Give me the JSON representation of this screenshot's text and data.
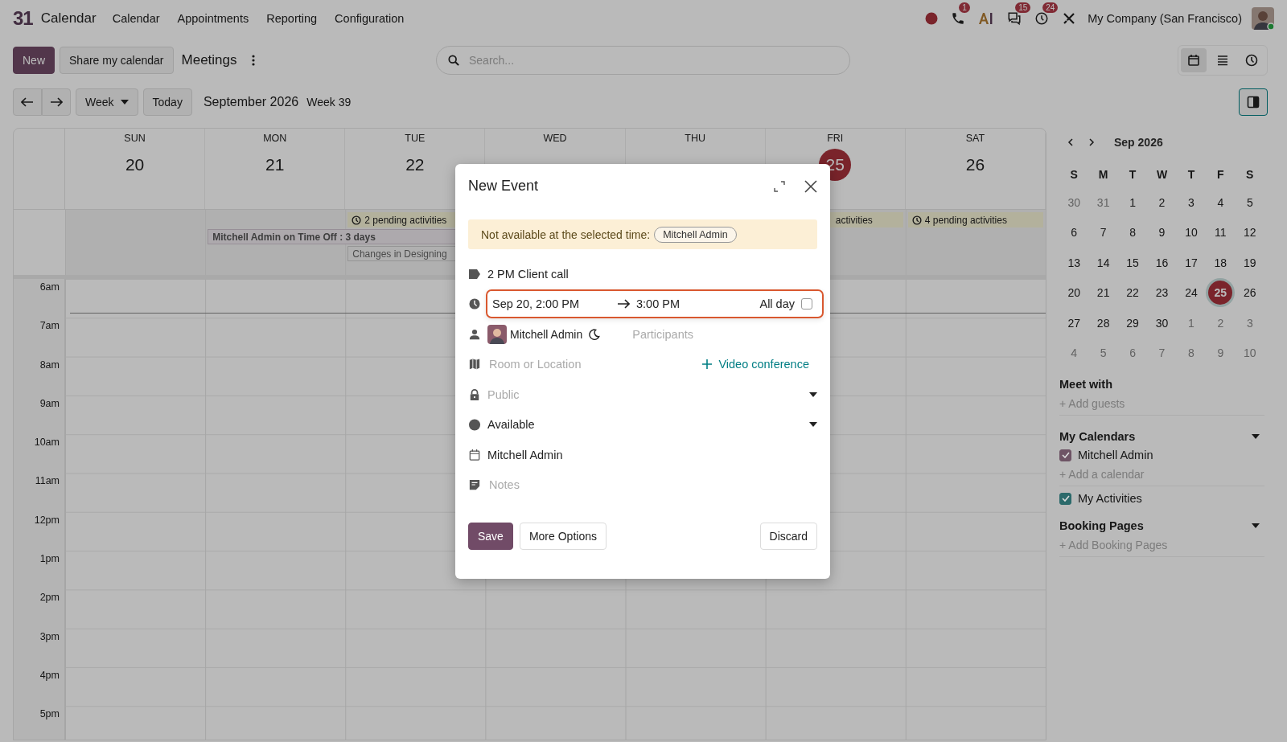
{
  "topbar": {
    "logo": "31",
    "app_name": "Calendar",
    "menu": [
      "Calendar",
      "Appointments",
      "Reporting",
      "Configuration"
    ],
    "systray": [
      {
        "kind": "record"
      },
      {
        "kind": "phone",
        "badge": "1"
      },
      {
        "kind": "ai"
      },
      {
        "kind": "chat",
        "badge": "15"
      },
      {
        "kind": "clock",
        "badge": "24"
      },
      {
        "kind": "tools"
      }
    ],
    "company": "My Company (San Francisco)"
  },
  "control": {
    "new": "New",
    "share": "Share my calendar",
    "title": "Meetings",
    "search": {
      "placeholder": "Search..."
    },
    "views": [
      {
        "kind": "calendar",
        "selected": true
      },
      {
        "kind": "list",
        "selected": false
      },
      {
        "kind": "activity",
        "selected": false
      }
    ],
    "scale": "Week",
    "today": "Today",
    "period": "September 2026",
    "week": "Week 39"
  },
  "days": [
    {
      "dow": "SUN",
      "day": "20",
      "today": false
    },
    {
      "dow": "MON",
      "day": "21",
      "today": false
    },
    {
      "dow": "TUE",
      "day": "22",
      "today": false
    },
    {
      "dow": "WED"
    },
    {
      "dow": "THU"
    },
    {
      "dow": "FRI",
      "day": "25",
      "today": true
    },
    {
      "dow": "SAT",
      "day": "26",
      "today": false
    }
  ],
  "allday_events": [
    {
      "kind": "activity",
      "label": "2 pending activities"
    },
    {
      "kind": "partial",
      "label": "activities"
    },
    {
      "kind": "activity",
      "label": "4 pending activities"
    },
    {
      "kind": "timeoff",
      "label": "Mitchell Admin on Time Off : 3 days"
    },
    {
      "kind": "task",
      "label": "Changes in Designing"
    }
  ],
  "hours": [
    "6am",
    "7am",
    "8am",
    "9am",
    "10am",
    "11am",
    "12pm",
    "1pm",
    "2pm",
    "3pm",
    "4pm",
    "5pm"
  ],
  "modal": {
    "title": "New Event",
    "warning": "Not available at the selected time:",
    "warning_person": "Mitchell Admin",
    "name": "2 PM Client call",
    "start": "Sep 20, 2:00 PM",
    "end": "3:00 PM",
    "all_day_label": "All day",
    "all_day": false,
    "attendee": "Mitchell Admin",
    "participants_placeholder": "Participants",
    "location_placeholder": "Room or Location",
    "video": "Video conference",
    "privacy_placeholder": "Public",
    "availability": "Available",
    "calendar": "Mitchell Admin",
    "notes_placeholder": "Notes",
    "save": "Save",
    "more": "More Options",
    "discard": "Discard"
  },
  "sidebar": {
    "month": "Sep 2026",
    "weekdays": [
      "S",
      "M",
      "T",
      "W",
      "T",
      "F",
      "S"
    ],
    "weeks": [
      [
        {
          "d": "30",
          "other": true
        },
        {
          "d": "31",
          "other": true
        },
        {
          "d": "1",
          "other": false
        },
        {
          "d": "2",
          "other": false
        },
        {
          "d": "3",
          "other": false
        },
        {
          "d": "4",
          "other": false
        },
        {
          "d": "5",
          "other": false
        }
      ],
      [
        {
          "d": "6",
          "other": false
        },
        {
          "d": "7",
          "other": false
        },
        {
          "d": "8",
          "other": false
        },
        {
          "d": "9",
          "other": false
        },
        {
          "d": "10",
          "other": false
        },
        {
          "d": "11",
          "other": false
        },
        {
          "d": "12",
          "other": false
        }
      ],
      [
        {
          "d": "13",
          "other": false
        },
        {
          "d": "14",
          "other": false
        },
        {
          "d": "15",
          "other": false
        },
        {
          "d": "16",
          "other": false
        },
        {
          "d": "17",
          "other": false
        },
        {
          "d": "18",
          "other": false
        },
        {
          "d": "19",
          "other": false
        }
      ],
      [
        {
          "d": "20",
          "other": false
        },
        {
          "d": "21",
          "other": false
        },
        {
          "d": "22",
          "other": false
        },
        {
          "d": "23",
          "other": false
        },
        {
          "d": "24",
          "other": false
        },
        {
          "d": "25",
          "other": false,
          "selected": true
        },
        {
          "d": "26",
          "other": false
        }
      ],
      [
        {
          "d": "27",
          "other": false
        },
        {
          "d": "28",
          "other": false
        },
        {
          "d": "29",
          "other": false
        },
        {
          "d": "30",
          "other": false
        },
        {
          "d": "1",
          "other": true
        },
        {
          "d": "2",
          "other": true
        },
        {
          "d": "3",
          "other": true
        }
      ],
      [
        {
          "d": "4",
          "other": true
        },
        {
          "d": "5",
          "other": true
        },
        {
          "d": "6",
          "other": true
        },
        {
          "d": "7",
          "other": true
        },
        {
          "d": "8",
          "other": true
        },
        {
          "d": "9",
          "other": true
        },
        {
          "d": "10",
          "other": true
        }
      ]
    ],
    "meet_with": {
      "title": "Meet with",
      "placeholder": "+ Add guests"
    },
    "my_calendars": {
      "title": "My Calendars",
      "items": [
        {
          "label": "Mitchell Admin",
          "checked": true,
          "color": "#6e5465"
        }
      ],
      "add": "+ Add a calendar"
    },
    "activities": {
      "label": "My Activities",
      "checked": true,
      "color": "#2c6a6b"
    },
    "booking": {
      "title": "Booking Pages",
      "add": "+ Add Booking Pages"
    }
  }
}
